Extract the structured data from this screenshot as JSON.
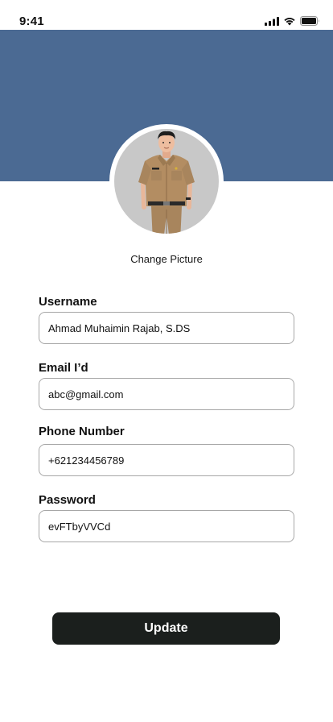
{
  "status_bar": {
    "time": "9:41",
    "icons": [
      "signal-icon",
      "wifi-icon",
      "battery-icon"
    ]
  },
  "colors": {
    "header": "#4b6a93",
    "button": "#1b1f1d",
    "field_border": "#a7a7a7"
  },
  "profile": {
    "avatar": "person-in-khaki-uniform",
    "change_picture_label": "Change Picture"
  },
  "form": {
    "username": {
      "label": "Username",
      "value": "Ahmad Muhaimin Rajab, S.DS"
    },
    "email": {
      "label": "Email I’d",
      "value": "abc@gmail.com"
    },
    "phone": {
      "label": "Phone Number",
      "value": "+621234456789"
    },
    "password": {
      "label": "Password",
      "value": "evFTbyVVCd"
    }
  },
  "update_button": {
    "label": "Update"
  }
}
